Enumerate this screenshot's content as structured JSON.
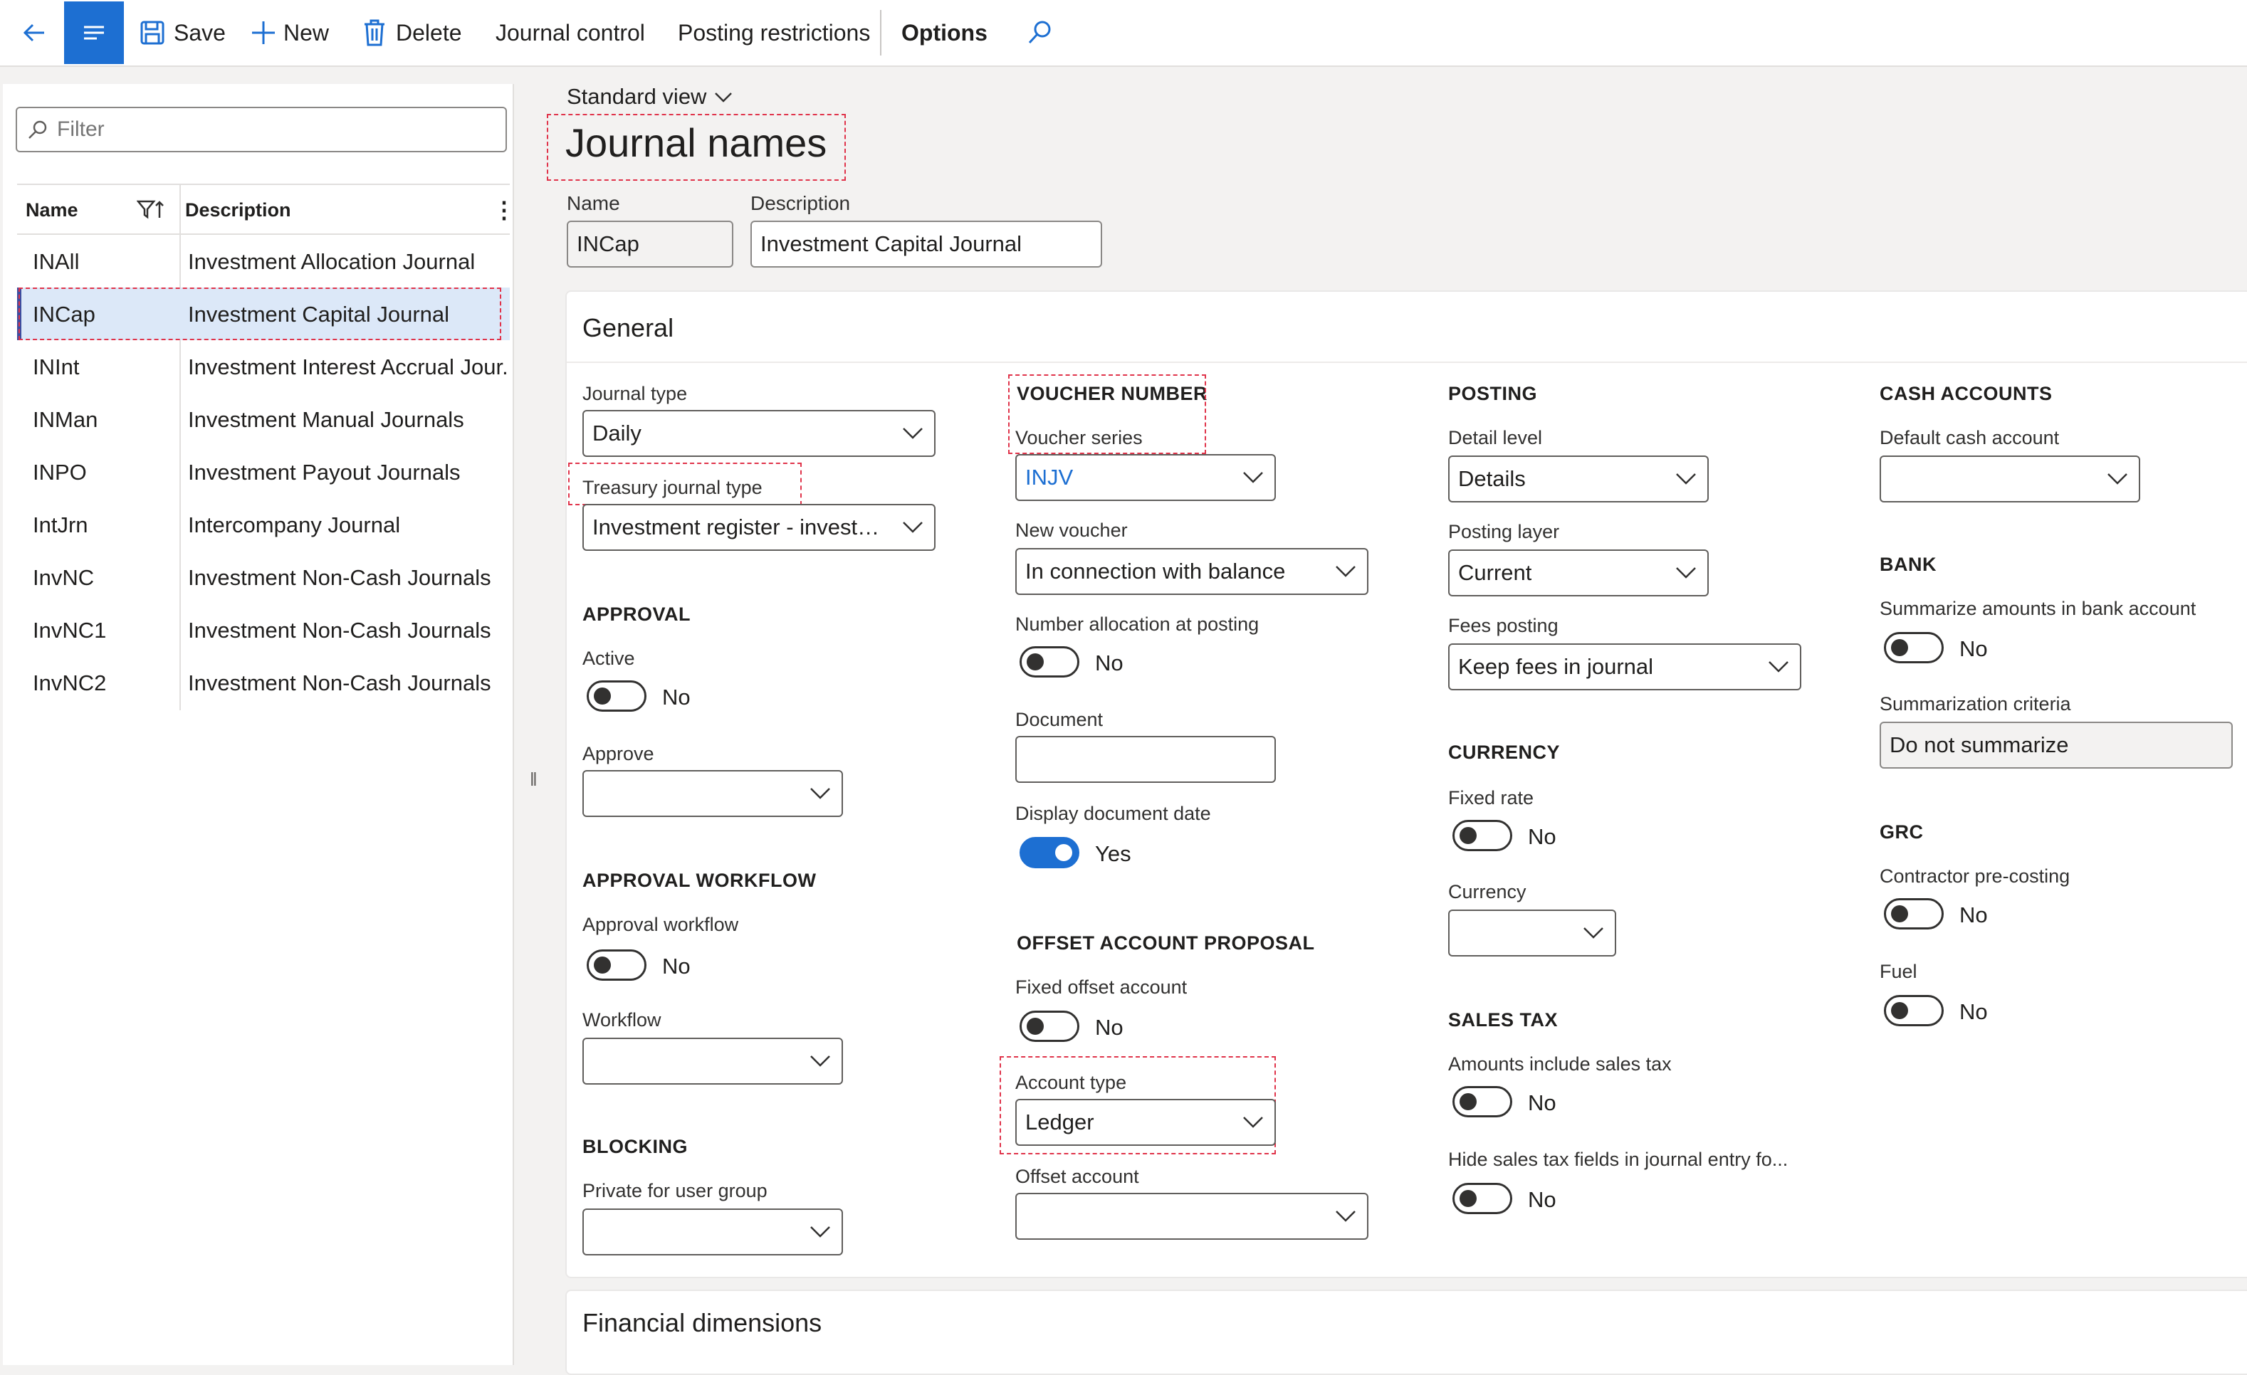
{
  "toolbar": {
    "save": "Save",
    "new": "New",
    "delete": "Delete",
    "journal_control": "Journal control",
    "posting_restrictions": "Posting restrictions",
    "options": "Options",
    "icons": [
      "back-arrow-icon",
      "menu-lines-icon",
      "save-disk-icon",
      "plus-icon",
      "trash-icon",
      "search-icon"
    ]
  },
  "list": {
    "filter_placeholder": "Filter",
    "columns": {
      "name": "Name",
      "description": "Description"
    },
    "rows": [
      {
        "name": "INAll",
        "description": "Investment Allocation Journal"
      },
      {
        "name": "INCap",
        "description": "Investment Capital Journal",
        "selected": true
      },
      {
        "name": "INInt",
        "description": "Investment Interest Accrual Jour..."
      },
      {
        "name": "INMan",
        "description": "Investment Manual Journals"
      },
      {
        "name": "INPO",
        "description": "Investment Payout Journals"
      },
      {
        "name": "IntJrn",
        "description": "Intercompany Journal"
      },
      {
        "name": "InvNC",
        "description": "Investment Non-Cash Journals"
      },
      {
        "name": "InvNC1",
        "description": "Investment Non-Cash Journals"
      },
      {
        "name": "InvNC2",
        "description": "Investment Non-Cash Journals"
      }
    ]
  },
  "header": {
    "view": "Standard view",
    "title": "Journal names",
    "name_label": "Name",
    "name_value": "INCap",
    "description_label": "Description",
    "description_value": "Investment Capital Journal"
  },
  "general": {
    "title": "General",
    "journal_type_label": "Journal type",
    "journal_type_value": "Daily",
    "treasury_label": "Treasury journal type",
    "treasury_value": "Investment register - investm...",
    "approval": {
      "title": "APPROVAL",
      "active_label": "Active",
      "active_value": "No",
      "approve_label": "Approve"
    },
    "approval_workflow": {
      "title": "APPROVAL WORKFLOW",
      "approval_workflow_label": "Approval workflow",
      "approval_workflow_value": "No",
      "workflow_label": "Workflow"
    },
    "blocking": {
      "title": "BLOCKING",
      "private_label": "Private for user group"
    },
    "voucher": {
      "title": "VOUCHER NUMBER",
      "series_label": "Voucher series",
      "series_value": "INJV",
      "new_voucher_label": "New voucher",
      "new_voucher_value": "In connection with balance",
      "number_alloc_label": "Number allocation at posting",
      "number_alloc_value": "No",
      "document_label": "Document",
      "display_date_label": "Display document date",
      "display_date_value": "Yes"
    },
    "offset": {
      "title": "OFFSET ACCOUNT PROPOSAL",
      "fixed_label": "Fixed offset account",
      "fixed_value": "No",
      "account_type_label": "Account type",
      "account_type_value": "Ledger",
      "offset_account_label": "Offset account"
    },
    "posting": {
      "title": "POSTING",
      "detail_label": "Detail level",
      "detail_value": "Details",
      "layer_label": "Posting layer",
      "layer_value": "Current",
      "fees_label": "Fees posting",
      "fees_value": "Keep fees in journal"
    },
    "currency": {
      "title": "CURRENCY",
      "fixed_rate_label": "Fixed rate",
      "fixed_rate_value": "No",
      "currency_label": "Currency"
    },
    "sales_tax": {
      "title": "SALES TAX",
      "include_label": "Amounts include sales tax",
      "include_value": "No",
      "hide_label": "Hide sales tax fields in journal entry fo...",
      "hide_value": "No"
    },
    "cash": {
      "title": "CASH ACCOUNTS",
      "default_label": "Default cash account"
    },
    "bank": {
      "title": "BANK",
      "summarize_label": "Summarize amounts in bank account",
      "summarize_value": "No",
      "criteria_label": "Summarization criteria",
      "criteria_value": "Do not summarize"
    },
    "grc": {
      "title": "GRC",
      "contractor_label": "Contractor pre-costing",
      "contractor_value": "No",
      "fuel_label": "Fuel",
      "fuel_value": "No"
    }
  },
  "financial_dimensions": {
    "title": "Financial dimensions"
  },
  "colors": {
    "accent": "#1d6fd2",
    "highlight_box": "#e0334a",
    "selected_row": "#dce8f8"
  }
}
